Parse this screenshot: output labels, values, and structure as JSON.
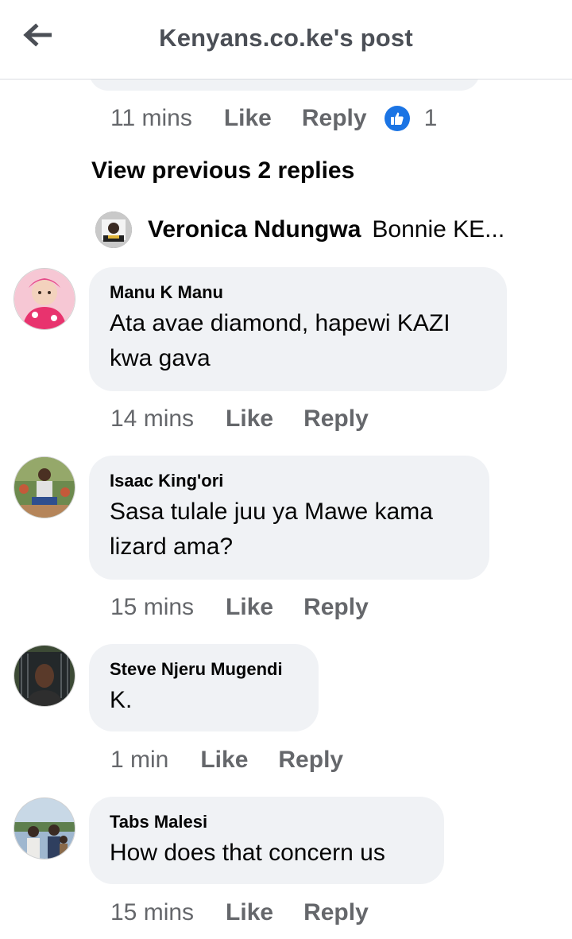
{
  "header": {
    "title": "Kenyans.co.ke's post",
    "back_icon": "arrow-left-icon"
  },
  "top_meta": {
    "time": "11 mins",
    "like": "Like",
    "reply": "Reply",
    "reaction_icon": "thumbs-up-icon",
    "reaction_count": "1"
  },
  "view_previous": "View previous 2 replies",
  "reply_preview": {
    "name": "Veronica Ndungwa",
    "text": "Bonnie KE..."
  },
  "comments": [
    {
      "name": "Manu K Manu",
      "text": "Ata avae diamond, hapewi KAZI kwa gava",
      "time": "14 mins",
      "like": "Like",
      "reply": "Reply"
    },
    {
      "name": "Isaac King'ori",
      "text": "Sasa tulale juu ya Mawe kama lizard ama?",
      "time": "15 mins",
      "like": "Like",
      "reply": "Reply"
    },
    {
      "name": "Steve Njeru Mugendi",
      "text": "K.",
      "time": "1 min",
      "like": "Like",
      "reply": "Reply"
    },
    {
      "name": "Tabs Malesi",
      "text": "How does that concern us",
      "time": "15 mins",
      "like": "Like",
      "reply": "Reply"
    }
  ],
  "colors": {
    "bubble_bg": "#f0f2f5",
    "meta_text": "#65676b",
    "like_blue": "#1b74e4"
  }
}
